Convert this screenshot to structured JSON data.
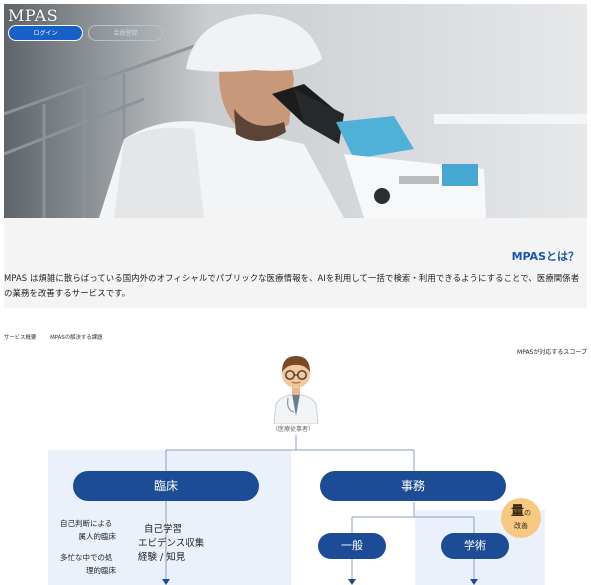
{
  "header": {
    "logo": "MPAS",
    "login_label": "ログイン",
    "register_label": "会員登録"
  },
  "about": {
    "title": "MPASとは？",
    "body": "MPAS は煩雑に散らばっている国内外のオフィシャルでパブリックな医療情報を、AIを利用して一括で検索・利用できるようにすることで、医療関係者の業務を改善するサービスです。"
  },
  "tabs": [
    {
      "label": "サービス概要"
    },
    {
      "label": "MPASの解決する課題"
    }
  ],
  "scope": {
    "caption": "MPASが対応するスコープ",
    "person_label": "（医療従事者）",
    "clinical": {
      "label": "臨床",
      "side_notes": [
        "自己判断による",
        "属人的臨床",
        "多忙な中での処",
        "理的臨床"
      ],
      "mid_notes": [
        "自己学習",
        "エビデンス収集",
        "経験 / 知見"
      ]
    },
    "office": {
      "label": "事務",
      "sub_general": "一般",
      "sub_academic": "学術"
    },
    "badge": {
      "big": "量",
      "small_top": "の",
      "small_bottom": "改善"
    }
  },
  "colors": {
    "brand_navy": "#1c4c95",
    "accent_blue": "#1a56b0",
    "login_blue": "#1560c9",
    "panel_blue": "#eaf1fb",
    "badge_orange": "#f7c882"
  }
}
